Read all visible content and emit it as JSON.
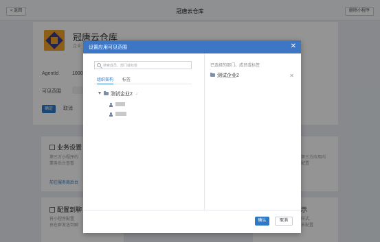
{
  "header": {
    "back_label": "< 返回",
    "title": "冠唐云仓库",
    "delete_label": "删除小程序"
  },
  "app": {
    "name": "冠唐云仓库",
    "subtitle": "企业",
    "agentid_label": "AgentId",
    "agentid_value": "1000",
    "visible_label": "可见范围",
    "confirm_label": "确定",
    "cancel_label": "取消"
  },
  "features": [
    {
      "title": "业务设置",
      "desc1": "第三方小程序的",
      "desc2": "業务后台查看",
      "link": "前往服务商后台"
    },
    {
      "title": "配置到聊",
      "desc1": "将小程序配置",
      "desc2": "员在群发送到聊"
    },
    {
      "desc1": "第三方应用内",
      "desc2": "配置"
    },
    {
      "title": "示",
      "desc1": "样式,",
      "desc2": "未配置"
    }
  ],
  "dialog": {
    "title": "设置应用可见范围",
    "close_icon": "close-icon",
    "search_placeholder": "搜索成员、部门或标签",
    "tabs": [
      "组织架构",
      "标签"
    ],
    "tree": {
      "root": "测试企业2"
    },
    "selected_title": "已选择的部门、成员或标签",
    "selected_items": [
      "测试企业2"
    ],
    "ok_label": "确认",
    "cancel_label": "取消"
  },
  "colors": {
    "header_blue": "#3d76c5",
    "primary_button": "#2d79c7",
    "overlay": "rgba(0,0,0,0.42)"
  }
}
